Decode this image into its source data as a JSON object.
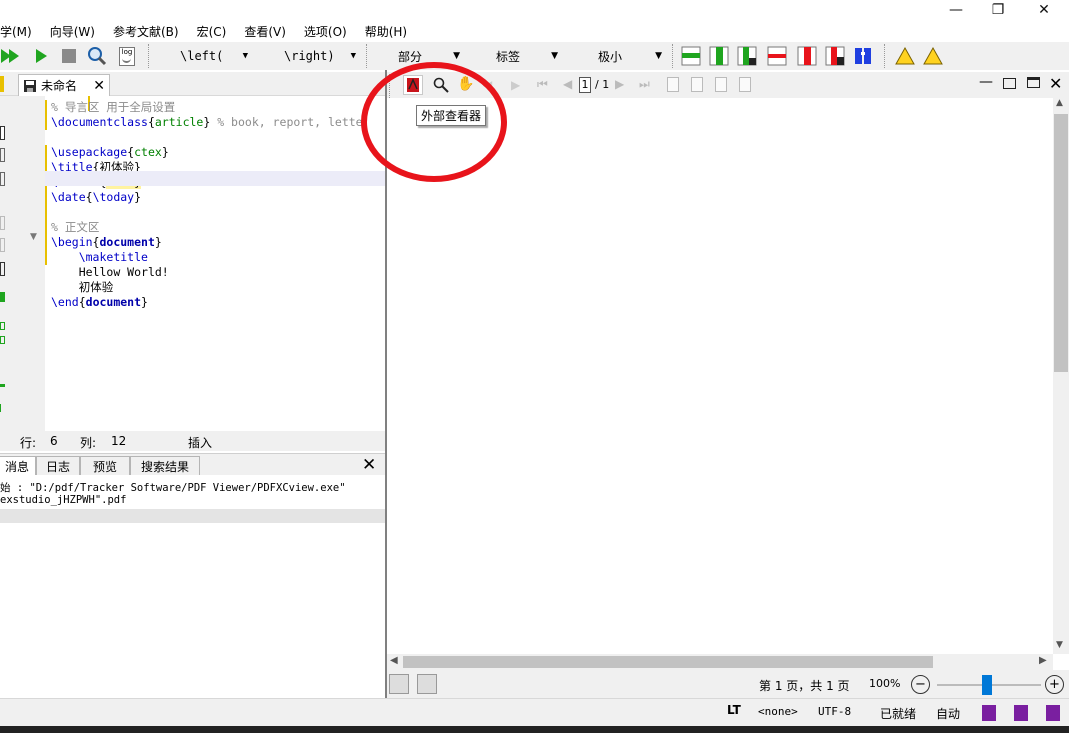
{
  "window": {
    "minimize_glyph": "—",
    "restore_glyph": "❐",
    "close_glyph": "✕"
  },
  "menubar": {
    "items": [
      "学(M)",
      "向导(W)",
      "参考文献(B)",
      "宏(C)",
      "查看(V)",
      "选项(O)",
      "帮助(H)"
    ]
  },
  "toolbar": {
    "left_paren": "\\left(",
    "right_paren": "\\right)",
    "structure": "部分",
    "label": "标签",
    "size": "极小",
    "log_label": "log"
  },
  "editor": {
    "tab_title": "未命名",
    "lines": [
      {
        "text": "% 导言区 用于全局设置"
      },
      {
        "cmd": "\\documentclass",
        "arg": "article",
        "rest": " % book, report, lette"
      },
      {
        "text": ""
      },
      {
        "cmd": "\\usepackage",
        "arg": "ctex"
      },
      {
        "cmd": "\\title",
        "arg": "初体验"
      },
      {
        "cmd": "\\author",
        "arg": "XXXX"
      },
      {
        "cmd": "\\date",
        "arg": "\\today"
      },
      {
        "text": ""
      },
      {
        "text": "% 正文区"
      },
      {
        "cmd": "\\begin",
        "arg": "document"
      },
      {
        "indent": "    ",
        "cmd": "\\maketitle"
      },
      {
        "indent": "    ",
        "text": "Hellow World!"
      },
      {
        "indent": "    ",
        "text": "初体验"
      },
      {
        "cmd": "\\end",
        "arg": "document"
      }
    ],
    "status": {
      "row_label": "行:",
      "row_value": "6",
      "col_label": "列:",
      "col_value": "12",
      "mode": "插入"
    }
  },
  "messages": {
    "tabs": [
      "消息",
      "日志",
      "预览",
      "搜索结果"
    ],
    "lines": [
      "始 : \"D:/pdf/Tracker Software/PDF Viewer/PDFXCview.exe\"",
      "exstudio_jHZPWH\".pdf"
    ]
  },
  "viewer": {
    "page_input": "1",
    "page_total": "/ 1",
    "tooltip": "外部查看器",
    "page_status": "第 1 页，共 1 页",
    "zoom": "100%",
    "zoom_level_fraction": 0.48
  },
  "statusbar": {
    "lt": "LT",
    "language": "<none>",
    "encoding": "UTF-8",
    "ready": "已就绪",
    "auto": "自动"
  },
  "colors": {
    "run_green": "#1fa51f",
    "annotation_red": "#e8141b",
    "accent_blue": "#0078d7"
  }
}
